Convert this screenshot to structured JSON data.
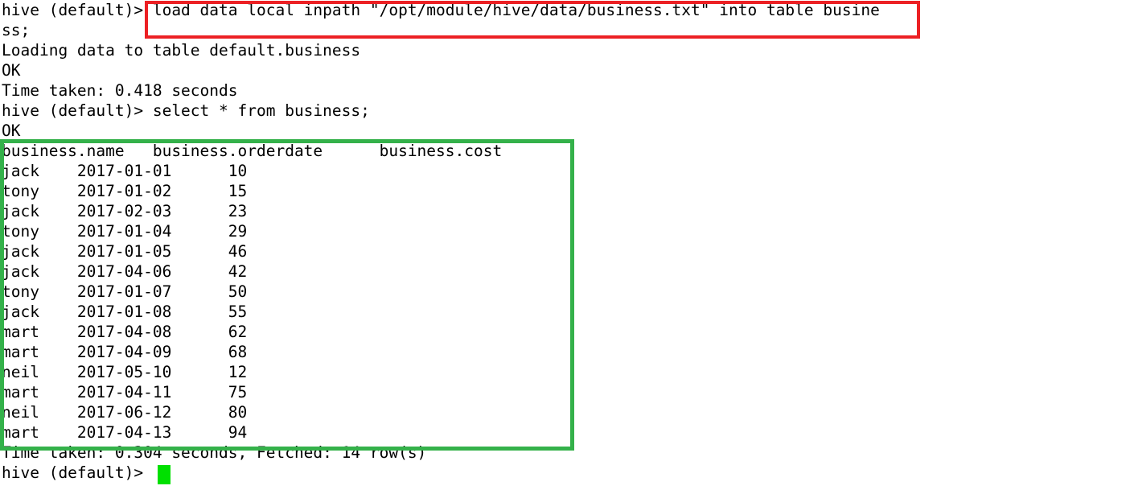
{
  "terminal": {
    "prompt": "hive (default)>",
    "lines": [
      "hive (default)> load data local inpath \"/opt/module/hive/data/business.txt\" into table busine",
      "ss;",
      "Loading data to table default.business",
      "OK",
      "Time taken: 0.418 seconds",
      "hive (default)> select * from business;",
      "OK",
      "business.name   business.orderdate      business.cost",
      "jack    2017-01-01      10",
      "tony    2017-01-02      15",
      "jack    2017-02-03      23",
      "tony    2017-01-04      29",
      "jack    2017-01-05      46",
      "jack    2017-04-06      42",
      "tony    2017-01-07      50",
      "jack    2017-01-08      55",
      "mart    2017-04-08      62",
      "mart    2017-04-09      68",
      "neil    2017-05-10      12",
      "mart    2017-04-11      75",
      "neil    2017-06-12      80",
      "mart    2017-04-13      94",
      "Time taken: 0.304 seconds, Fetched: 14 row(s)",
      "hive (default)> "
    ],
    "commands": {
      "load_command": "load data local inpath \"/opt/module/hive/data/business.txt\" into table business;",
      "select_command": "select * from business;"
    },
    "status": {
      "loading_message": "Loading data to table default.business",
      "ok_1": "OK",
      "time_taken_load": "Time taken: 0.418 seconds",
      "ok_2": "OK",
      "time_taken_select": "Time taken: 0.304 seconds, Fetched: 14 row(s)"
    },
    "result_table": {
      "columns": [
        "business.name",
        "business.orderdate",
        "business.cost"
      ],
      "rows": [
        [
          "jack",
          "2017-01-01",
          "10"
        ],
        [
          "tony",
          "2017-01-02",
          "15"
        ],
        [
          "jack",
          "2017-02-03",
          "23"
        ],
        [
          "tony",
          "2017-01-04",
          "29"
        ],
        [
          "jack",
          "2017-01-05",
          "46"
        ],
        [
          "jack",
          "2017-04-06",
          "42"
        ],
        [
          "tony",
          "2017-01-07",
          "50"
        ],
        [
          "jack",
          "2017-01-08",
          "55"
        ],
        [
          "mart",
          "2017-04-08",
          "62"
        ],
        [
          "mart",
          "2017-04-09",
          "68"
        ],
        [
          "neil",
          "2017-05-10",
          "12"
        ],
        [
          "mart",
          "2017-04-11",
          "75"
        ],
        [
          "neil",
          "2017-06-12",
          "80"
        ],
        [
          "mart",
          "2017-04-13",
          "94"
        ]
      ],
      "row_count": "14"
    },
    "cursor": {
      "glyph": " ",
      "color": "#00e000"
    },
    "annotations": {
      "red_box_label": "load-command-highlight",
      "red_box_color": "#ec2024",
      "green_box_label": "query-result-highlight",
      "green_box_color": "#34b14a"
    }
  }
}
